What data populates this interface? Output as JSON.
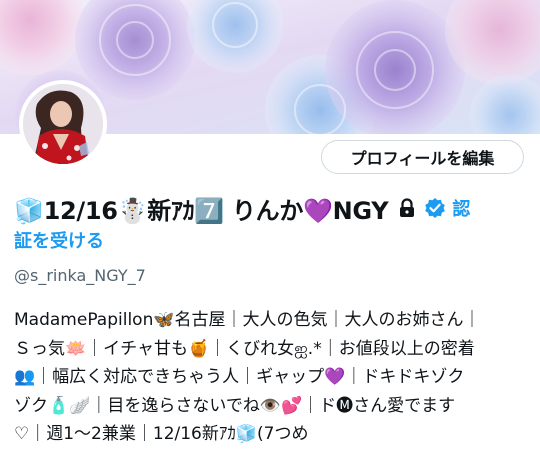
{
  "profile": {
    "edit_button_label": "プロフィールを編集",
    "display_name": "🧊12/16☃️新ｱｶ7️⃣ りんか💜NGY",
    "verify_label_part1": "認",
    "verify_label_part2": "証を受ける",
    "handle": "@s_rinka_NGY_7",
    "bio_lines": [
      "MadamePapillon🦋名古屋｜大人の色気｜大人のお姉さん｜",
      "Ｓっ気🪷｜イチャ甘も🍯｜くびれ女ஐ.*｜お値段以上の密着",
      "👥｜幅広く対応できちゃう人｜ギャップ💜｜ドキドキゾク",
      "ゾク🧴🪽｜目を逸らさないでね👁️💕｜ド🅜さん愛でます",
      "♡｜週1〜2兼業｜12/16新ｱｶ🧊(7つめ"
    ]
  },
  "colors": {
    "accent": "#1d9bf0",
    "text": "#0f1419",
    "muted": "#536471",
    "border": "#cfd9de"
  },
  "icons": {
    "lock": "lock-icon",
    "verified": "verified-badge-icon"
  }
}
